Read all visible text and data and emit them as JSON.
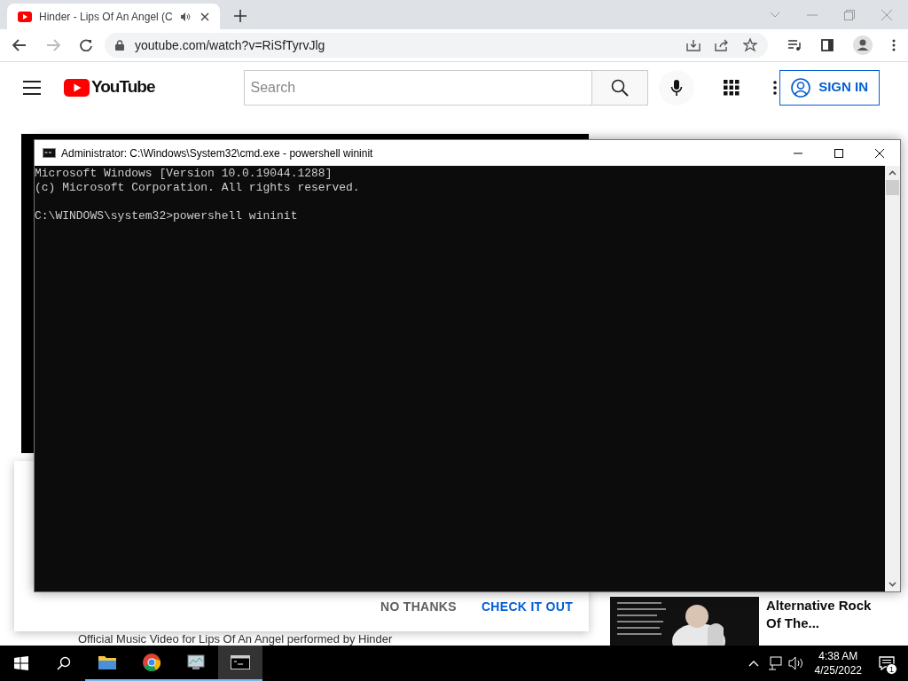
{
  "browser": {
    "tab": {
      "title": "Hinder - Lips Of An Angel (C",
      "audio": true
    },
    "url": "youtube.com/watch?v=RiSfTyrvJlg"
  },
  "youtube": {
    "logo": "YouTube",
    "search": {
      "placeholder": "Search"
    },
    "sign_in": "SIGN IN",
    "dialog": {
      "buttons": [
        {
          "label": "NO THANKS",
          "kind": "secondary"
        },
        {
          "label": "CHECK IT OUT",
          "kind": "primary"
        }
      ]
    },
    "description": "Official Music Video for Lips Of An Angel performed by Hinder",
    "recommendation": {
      "title": "Alternative Rock Of The..."
    }
  },
  "console": {
    "title": "Administrator: C:\\Windows\\System32\\cmd.exe - powershell  wininit",
    "banner": [
      "Microsoft Windows [Version 10.0.19044.1288]",
      "(c) Microsoft Corporation. All rights reserved."
    ],
    "prompt": "C:\\WINDOWS\\system32>powershell wininit"
  },
  "taskbar": {
    "apps": [
      {
        "kind": "explorer",
        "selected": false
      },
      {
        "kind": "chrome",
        "selected": false
      },
      {
        "kind": "monitor",
        "selected": false
      },
      {
        "kind": "terminal",
        "selected": true
      }
    ],
    "time": "4:38 AM",
    "date": "4/25/2022",
    "notifications": "1"
  }
}
